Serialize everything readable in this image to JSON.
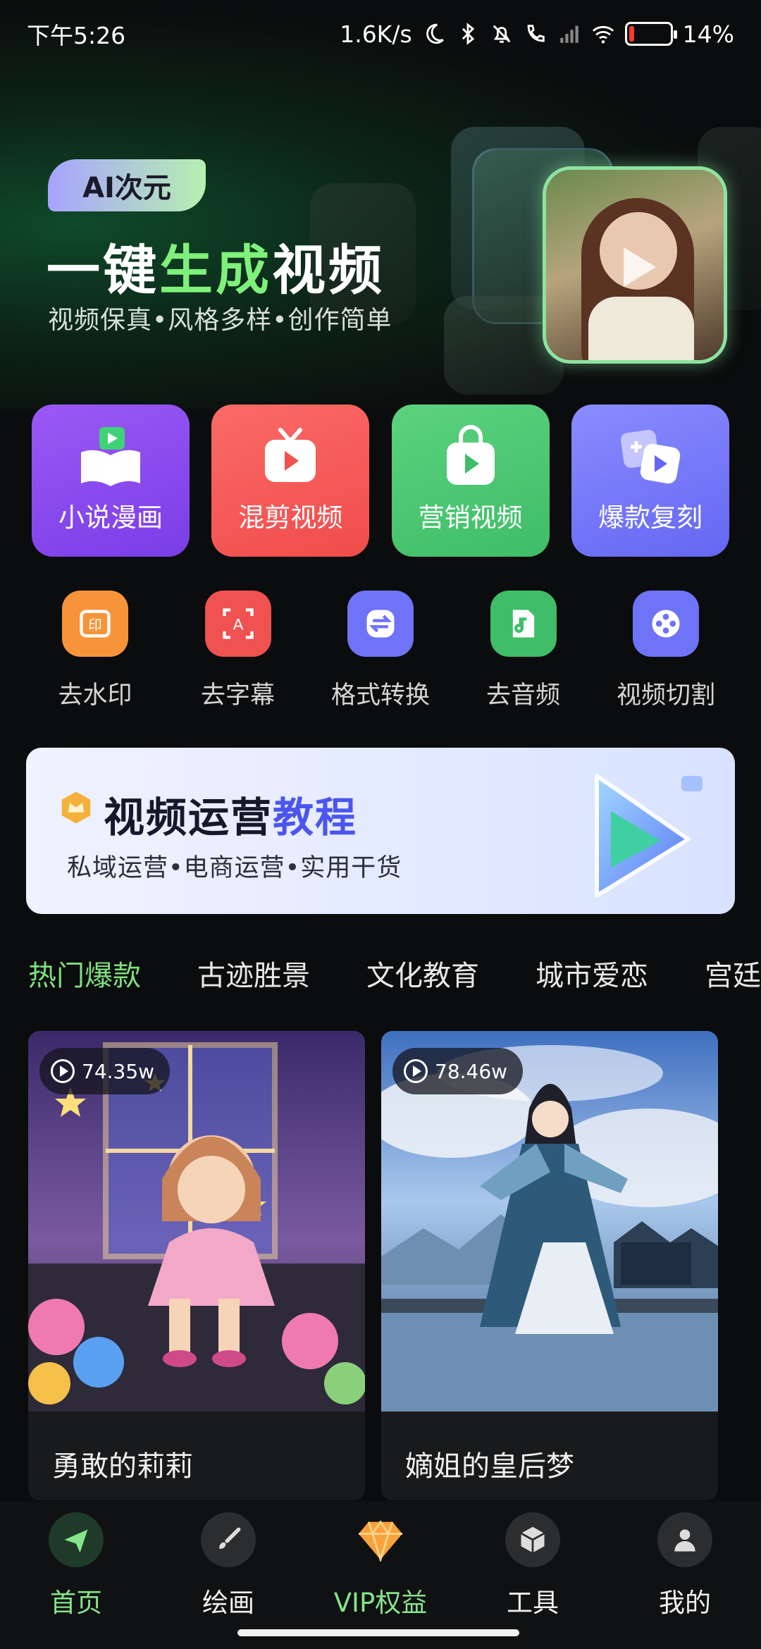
{
  "status_bar": {
    "time": "下午5:26",
    "net_speed": "1.6K/s",
    "battery": "14%",
    "battery_level": 0.14
  },
  "hero": {
    "badge": "AI次元",
    "title_pre": "一键",
    "title_hl": "生成",
    "title_post": "视频",
    "subtitle": "视频保真•风格多样•创作简单"
  },
  "features": [
    {
      "label": "小说漫画",
      "color_from": "#9b58f5",
      "color_to": "#7a3ee6",
      "icon": "book-play-icon"
    },
    {
      "label": "混剪视频",
      "color_from": "#fb6b66",
      "color_to": "#f04c4c",
      "icon": "tv-play-icon"
    },
    {
      "label": "营销视频",
      "color_from": "#5bd27e",
      "color_to": "#3fbd68",
      "icon": "bag-play-icon"
    },
    {
      "label": "爆款复刻",
      "color_from": "#8a8cff",
      "color_to": "#6467f2",
      "icon": "copy-play-icon"
    }
  ],
  "tools": [
    {
      "label": "去水印",
      "color": "#f7943a",
      "icon": "watermark-icon"
    },
    {
      "label": "去字幕",
      "color": "#f05151",
      "icon": "subtitle-icon"
    },
    {
      "label": "格式转换",
      "color": "#6f73f7",
      "icon": "convert-icon"
    },
    {
      "label": "去音频",
      "color": "#3fbd68",
      "icon": "audio-file-icon"
    },
    {
      "label": "视频切割",
      "color": "#6f73f7",
      "icon": "film-reel-icon"
    }
  ],
  "banner": {
    "title_pre": "视频运营",
    "title_hl": "教程",
    "subtitle": "私域运营•电商运营•实用干货"
  },
  "tabs": [
    "热门爆款",
    "古迹胜景",
    "文化教育",
    "城市爱恋",
    "宫廷"
  ],
  "cards": [
    {
      "views": "74.35w",
      "title": "勇敢的莉莉"
    },
    {
      "views": "78.46w",
      "title": "嫡姐的皇后梦"
    }
  ],
  "nav": [
    {
      "label": "首页",
      "icon": "paper-plane-icon"
    },
    {
      "label": "绘画",
      "icon": "brush-icon"
    },
    {
      "label": "VIP权益",
      "icon": "diamond-icon"
    },
    {
      "label": "工具",
      "icon": "cube-icon"
    },
    {
      "label": "我的",
      "icon": "user-icon"
    }
  ]
}
